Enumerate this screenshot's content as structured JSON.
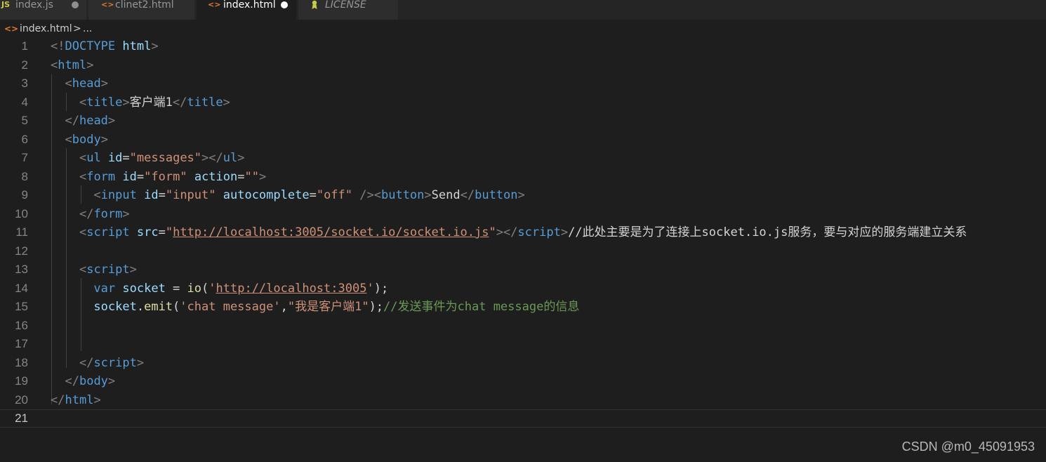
{
  "tabs": [
    {
      "label": "index.js",
      "icon": "JS",
      "icon_name": "javascript-file-icon",
      "dirty": true,
      "active": false
    },
    {
      "label": "clinet2.html",
      "icon": "<>",
      "icon_name": "html-file-icon",
      "dirty": false,
      "active": false
    },
    {
      "label": "index.html",
      "icon": "<>",
      "icon_name": "html-file-icon",
      "dirty": true,
      "active": true
    },
    {
      "label": "LICENSE",
      "icon": "license",
      "icon_name": "license-file-icon",
      "dirty": false,
      "active": false
    }
  ],
  "breadcrumb": {
    "icon": "<>",
    "file": "index.html",
    "separator": ">",
    "more": "..."
  },
  "editor": {
    "line_numbers": [
      "1",
      "2",
      "3",
      "4",
      "5",
      "6",
      "7",
      "8",
      "9",
      "10",
      "11",
      "12",
      "13",
      "14",
      "15",
      "16",
      "17",
      "18",
      "19",
      "20",
      "21"
    ],
    "lines": [
      [
        [
          "p",
          "<!"
        ],
        [
          "t",
          "DOCTYPE"
        ],
        [
          "x",
          " "
        ],
        [
          "a",
          "html"
        ],
        [
          "p",
          ">"
        ]
      ],
      [
        [
          "p",
          "<"
        ],
        [
          "t",
          "html"
        ],
        [
          "p",
          ">"
        ]
      ],
      [
        [
          "x",
          "  "
        ],
        [
          "p",
          "<"
        ],
        [
          "t",
          "head"
        ],
        [
          "p",
          ">"
        ]
      ],
      [
        [
          "x",
          "    "
        ],
        [
          "p",
          "<"
        ],
        [
          "t",
          "title"
        ],
        [
          "p",
          ">"
        ],
        [
          "x",
          "客户端1"
        ],
        [
          "p",
          "</"
        ],
        [
          "t",
          "title"
        ],
        [
          "p",
          ">"
        ]
      ],
      [
        [
          "x",
          "  "
        ],
        [
          "p",
          "</"
        ],
        [
          "t",
          "head"
        ],
        [
          "p",
          ">"
        ]
      ],
      [
        [
          "x",
          "  "
        ],
        [
          "p",
          "<"
        ],
        [
          "t",
          "body"
        ],
        [
          "p",
          ">"
        ]
      ],
      [
        [
          "x",
          "    "
        ],
        [
          "p",
          "<"
        ],
        [
          "t",
          "ul"
        ],
        [
          "x",
          " "
        ],
        [
          "a",
          "id"
        ],
        [
          "x",
          "="
        ],
        [
          "s",
          "\"messages\""
        ],
        [
          "p",
          "></"
        ],
        [
          "t",
          "ul"
        ],
        [
          "p",
          ">"
        ]
      ],
      [
        [
          "x",
          "    "
        ],
        [
          "p",
          "<"
        ],
        [
          "t",
          "form"
        ],
        [
          "x",
          " "
        ],
        [
          "a",
          "id"
        ],
        [
          "x",
          "="
        ],
        [
          "s",
          "\"form\""
        ],
        [
          "x",
          " "
        ],
        [
          "a",
          "action"
        ],
        [
          "x",
          "="
        ],
        [
          "s",
          "\"\""
        ],
        [
          "p",
          ">"
        ]
      ],
      [
        [
          "x",
          "      "
        ],
        [
          "p",
          "<"
        ],
        [
          "t",
          "input"
        ],
        [
          "x",
          " "
        ],
        [
          "a",
          "id"
        ],
        [
          "x",
          "="
        ],
        [
          "s",
          "\"input\""
        ],
        [
          "x",
          " "
        ],
        [
          "a",
          "autocomplete"
        ],
        [
          "x",
          "="
        ],
        [
          "s",
          "\"off\""
        ],
        [
          "x",
          " "
        ],
        [
          "p",
          "/><"
        ],
        [
          "t",
          "button"
        ],
        [
          "p",
          ">"
        ],
        [
          "x",
          "Send"
        ],
        [
          "p",
          "</"
        ],
        [
          "t",
          "button"
        ],
        [
          "p",
          ">"
        ]
      ],
      [
        [
          "x",
          "    "
        ],
        [
          "p",
          "</"
        ],
        [
          "t",
          "form"
        ],
        [
          "p",
          ">"
        ]
      ],
      [
        [
          "x",
          "    "
        ],
        [
          "p",
          "<"
        ],
        [
          "t",
          "script"
        ],
        [
          "x",
          " "
        ],
        [
          "a",
          "src"
        ],
        [
          "x",
          "="
        ],
        [
          "s",
          "\""
        ],
        [
          "su",
          "http://localhost:3005/socket.io/socket.io.js"
        ],
        [
          "s",
          "\""
        ],
        [
          "p",
          "></"
        ],
        [
          "t",
          "script"
        ],
        [
          "p",
          ">"
        ],
        [
          "x",
          "//此处主要是为了连接上socket.io.js服务，要与对应的服务端建立关系"
        ]
      ],
      [],
      [
        [
          "x",
          "    "
        ],
        [
          "p",
          "<"
        ],
        [
          "t",
          "script"
        ],
        [
          "p",
          ">"
        ]
      ],
      [
        [
          "x",
          "      "
        ],
        [
          "k",
          "var"
        ],
        [
          "x",
          " "
        ],
        [
          "v",
          "socket"
        ],
        [
          "x",
          " = "
        ],
        [
          "f",
          "io"
        ],
        [
          "x",
          "("
        ],
        [
          "s",
          "'"
        ],
        [
          "su",
          "http://localhost:3005"
        ],
        [
          "s",
          "'"
        ],
        [
          "x",
          ");"
        ]
      ],
      [
        [
          "x",
          "      "
        ],
        [
          "v",
          "socket"
        ],
        [
          "x",
          "."
        ],
        [
          "f",
          "emit"
        ],
        [
          "x",
          "("
        ],
        [
          "s",
          "'chat message'"
        ],
        [
          "x",
          ","
        ],
        [
          "s",
          "\"我是客户端1\""
        ],
        [
          "x",
          ");"
        ],
        [
          "c",
          "//发送事件为chat message的信息"
        ]
      ],
      [],
      [],
      [
        [
          "x",
          "    "
        ],
        [
          "p",
          "</"
        ],
        [
          "t",
          "script"
        ],
        [
          "p",
          ">"
        ]
      ],
      [
        [
          "x",
          "  "
        ],
        [
          "p",
          "</"
        ],
        [
          "t",
          "body"
        ],
        [
          "p",
          ">"
        ]
      ],
      [
        [
          "p",
          "</"
        ],
        [
          "t",
          "html"
        ],
        [
          "p",
          ">"
        ]
      ],
      []
    ],
    "current_line": 21
  },
  "watermark": "CSDN @m0_45091953",
  "colors": {
    "background": "#1e1e1e",
    "tab_inactive": "#2d2d2d",
    "tag": "#569cd6",
    "attribute": "#9cdcfe",
    "string": "#ce9178",
    "comment": "#6a9955",
    "function": "#dcdcaa",
    "js_icon": "#cbcb41",
    "html_icon": "#e37933",
    "license_icon": "#cbcb41"
  }
}
